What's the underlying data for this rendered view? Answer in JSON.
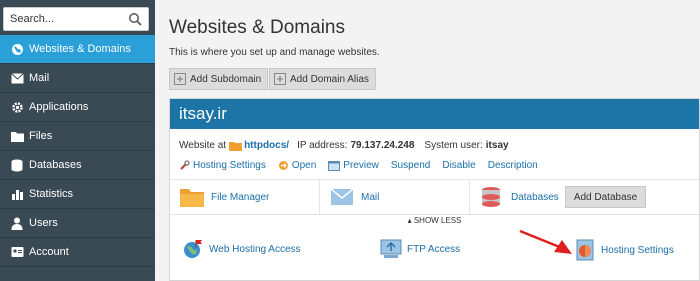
{
  "search": {
    "placeholder": "Search..."
  },
  "sidebar": {
    "items": [
      {
        "label": "Websites & Domains",
        "icon": "globe-icon",
        "active": true
      },
      {
        "label": "Mail",
        "icon": "envelope-icon"
      },
      {
        "label": "Applications",
        "icon": "gear-icon"
      },
      {
        "label": "Files",
        "icon": "folder-icon"
      },
      {
        "label": "Databases",
        "icon": "database-icon"
      },
      {
        "label": "Statistics",
        "icon": "bar-chart-icon"
      },
      {
        "label": "Users",
        "icon": "user-icon"
      },
      {
        "label": "Account",
        "icon": "account-icon"
      }
    ]
  },
  "page": {
    "title": "Websites & Domains",
    "subtitle": "This is where you set up and manage websites."
  },
  "toolbar": {
    "add_subdomain": "Add Subdomain",
    "add_domain_alias": "Add Domain Alias"
  },
  "domain": {
    "name": "itsay.ir",
    "website_at_label": "Website at",
    "docroot": "httpdocs/",
    "ip_label": "IP address:",
    "ip": "79.137.24.248",
    "system_user_label": "System user:",
    "system_user": "itsay",
    "actions": [
      "Hosting Settings",
      "Open",
      "Preview",
      "Suspend",
      "Disable",
      "Description"
    ],
    "tiles": {
      "file_manager": "File Manager",
      "mail": "Mail",
      "databases": "Databases",
      "add_database": "Add Database"
    },
    "show_less": "SHOW LESS",
    "bottom": {
      "web_hosting_access": "Web Hosting Access",
      "ftp_access": "FTP Access",
      "hosting_settings": "Hosting Settings"
    }
  },
  "colors": {
    "sidebar_bg": "#3a4a54",
    "active_nav": "#2a9fd8",
    "domain_header": "#1d74a6",
    "link": "#1b6fa9",
    "annotation_arrow": "#e02020"
  }
}
